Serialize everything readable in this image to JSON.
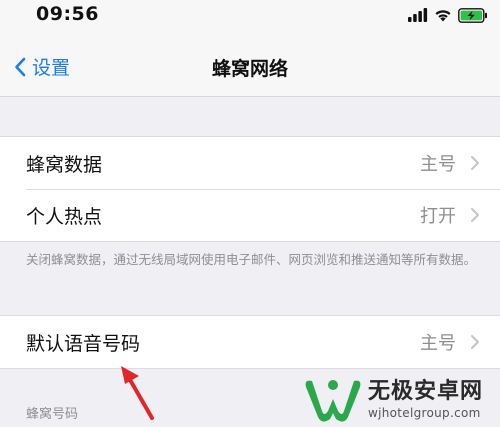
{
  "status_bar": {
    "time": "09:56",
    "icons": [
      "signal-icon",
      "wifi-icon",
      "battery-charging-icon"
    ]
  },
  "nav": {
    "back_label": "设置",
    "title": "蜂窝网络"
  },
  "group1": {
    "rows": [
      {
        "label": "蜂窝数据",
        "value": "主号"
      },
      {
        "label": "个人热点",
        "value": "打开"
      }
    ],
    "footnote": "关闭蜂窝数据，通过无线局域网使用电子邮件、网页浏览和推送通知等所有数据。"
  },
  "group2": {
    "rows": [
      {
        "label": "默认语音号码",
        "value": "主号"
      }
    ]
  },
  "section_header": "蜂窝号码",
  "watermark": {
    "title": "无极安卓网",
    "url": "wjhotelgroup.com"
  },
  "colors": {
    "accent": "#1a7cf5",
    "background": "#efeff4",
    "secondary_text": "#8e8e93",
    "annotation_red": "#e0262b",
    "watermark_green": "#2aa84a"
  }
}
